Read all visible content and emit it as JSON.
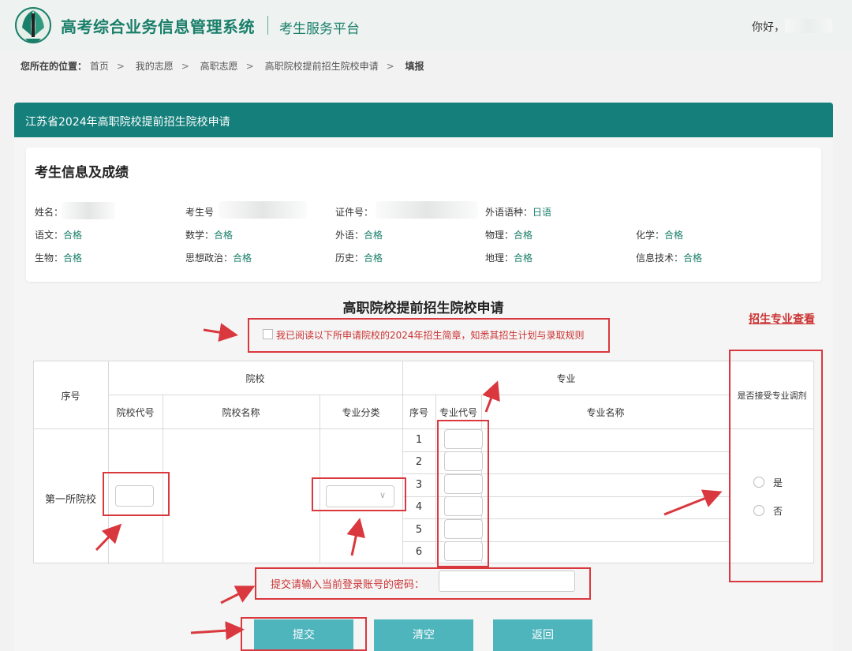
{
  "header": {
    "system_title": "高考综合业务信息管理系统",
    "platform": "考生服务平台",
    "greeting": "你好，"
  },
  "breadcrumb": {
    "label": "您所在的位置：",
    "items": [
      "首页",
      "我的志愿",
      "高职志愿",
      "高职院校提前招生院校申请"
    ],
    "current": "填报"
  },
  "panel": {
    "title": "江苏省2024年高职院校提前招生院校申请"
  },
  "student_info": {
    "title": "考生信息及成绩",
    "fields": [
      {
        "label": "姓名：",
        "value": ""
      },
      {
        "label": "考生号",
        "value": ""
      },
      {
        "label": "证件号：",
        "value": ""
      },
      {
        "label": "外语语种：",
        "value": "日语"
      },
      {
        "label": "语文：",
        "value": "合格"
      },
      {
        "label": "数学：",
        "value": "合格"
      },
      {
        "label": "外语：",
        "value": "合格"
      },
      {
        "label": "物理：",
        "value": "合格"
      },
      {
        "label": "化学：",
        "value": "合格"
      },
      {
        "label": "生物：",
        "value": "合格"
      },
      {
        "label": "思想政治：",
        "value": "合格"
      },
      {
        "label": "历史：",
        "value": "合格"
      },
      {
        "label": "地理：",
        "value": "合格"
      },
      {
        "label": "信息技术：",
        "value": "合格"
      }
    ]
  },
  "form": {
    "title": "高职院校提前招生院校申请",
    "view_majors_link": "招生专业查看",
    "agree_text": "我已阅读以下所申请院校的2024年招生简章，知悉其招生计划与录取规则",
    "table": {
      "col_index": "序号",
      "group_school": "院校",
      "school_code": "院校代号",
      "school_name": "院校名称",
      "major_category": "专业分类",
      "group_major": "专业",
      "major_index": "序号",
      "major_code": "专业代号",
      "major_name": "专业名称",
      "adjust": "是否接受专业调剂",
      "row_label": "第一所院校",
      "major_rows": [
        "1",
        "2",
        "3",
        "4",
        "5",
        "6"
      ],
      "adjust_options": [
        "是",
        "否"
      ]
    },
    "password_label": "提交请输入当前登录账号的密码：",
    "buttons": {
      "submit": "提交",
      "clear": "清空",
      "back": "返回"
    }
  },
  "colors": {
    "brand_green": "#1a7f6a",
    "panel_header": "#147f7b",
    "button": "#4fb5bd",
    "annotation_red": "#d9383e"
  }
}
